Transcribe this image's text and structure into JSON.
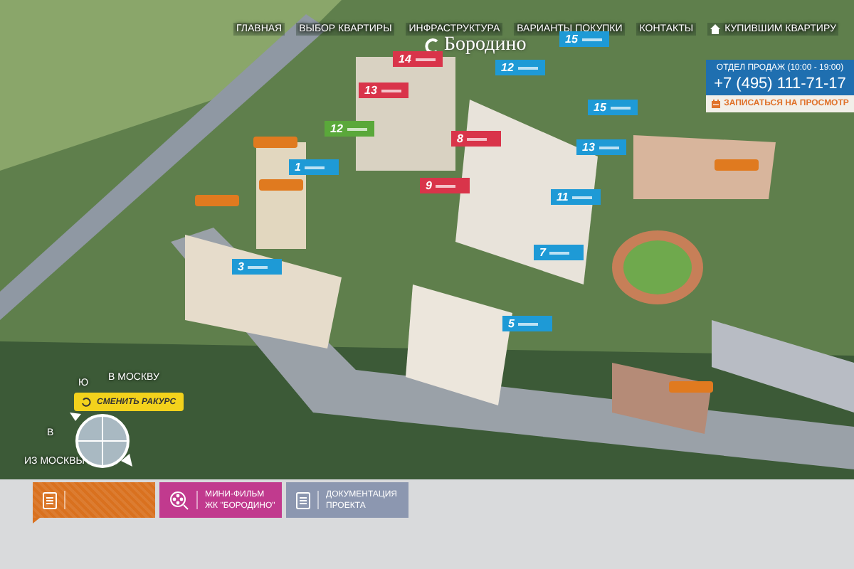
{
  "nav": [
    {
      "label": "ГЛАВНАЯ",
      "kind": "text"
    },
    {
      "label": "ВЫБОР КВАРТИРЫ",
      "kind": "text"
    },
    {
      "label": "ИНФРАСТРУКТУРА",
      "kind": "text"
    },
    {
      "label": "ВАРИАНТЫ ПОКУПКИ",
      "kind": "text"
    },
    {
      "label": "КОНТАКТЫ",
      "kind": "text"
    },
    {
      "label": "КУПИВШИМ КВАРТИРУ",
      "kind": "home"
    }
  ],
  "logo": "Бородино",
  "sales": {
    "title": "ОТДЕЛ ПРОДАЖ (10:00 - 19:00)",
    "phone": "+7 (495) 111-71-17",
    "button": "ЗАПИСАТЬСЯ НА ПРОСМОТР"
  },
  "markers": [
    {
      "number": "14",
      "color": "#d9344a"
    },
    {
      "number": "13",
      "color": "#d9344a"
    },
    {
      "number": "12",
      "color": "#1e9ad6"
    },
    {
      "number": "15",
      "color": "#1e9ad6"
    },
    {
      "number": "12",
      "color": "#5aa83a"
    },
    {
      "number": "8",
      "color": "#d9344a"
    },
    {
      "number": "15",
      "color": "#1e9ad6"
    },
    {
      "number": "13",
      "color": "#1e9ad6"
    },
    {
      "number": "9",
      "color": "#d9344a"
    },
    {
      "number": "11",
      "color": "#1e9ad6"
    },
    {
      "number": "1",
      "color": "#1e9ad6"
    },
    {
      "number": "7",
      "color": "#1e9ad6"
    },
    {
      "number": "3",
      "color": "#1e9ad6"
    },
    {
      "number": "5",
      "color": "#1e9ad6"
    }
  ],
  "poi_markers": [
    {
      "color": "#e07a1f"
    },
    {
      "color": "#e07a1f"
    },
    {
      "color": "#e07a1f"
    },
    {
      "color": "#e07a1f"
    },
    {
      "color": "#e07a1f"
    }
  ],
  "view_control": {
    "north_label": "В МОСКВУ",
    "south_label": "ИЗ МОСКВЫ",
    "letter_top": "Ю",
    "letter_left": "В",
    "button": "СМЕНИТЬ РАКУРС"
  },
  "bottom_tabs": [
    {
      "kind": "doc",
      "color": "#d9711f",
      "selected": true
    },
    {
      "kind": "film",
      "lines": [
        "МИНИ-ФИЛЬМ",
        "ЖК \"БОРОДИНО\""
      ],
      "color": "#c13a8e",
      "selected": false
    },
    {
      "kind": "doc",
      "lines": [
        "ДОКУМЕНТАЦИЯ",
        "ПРОЕКТА"
      ],
      "color": "#8c97b0",
      "selected": false
    }
  ]
}
